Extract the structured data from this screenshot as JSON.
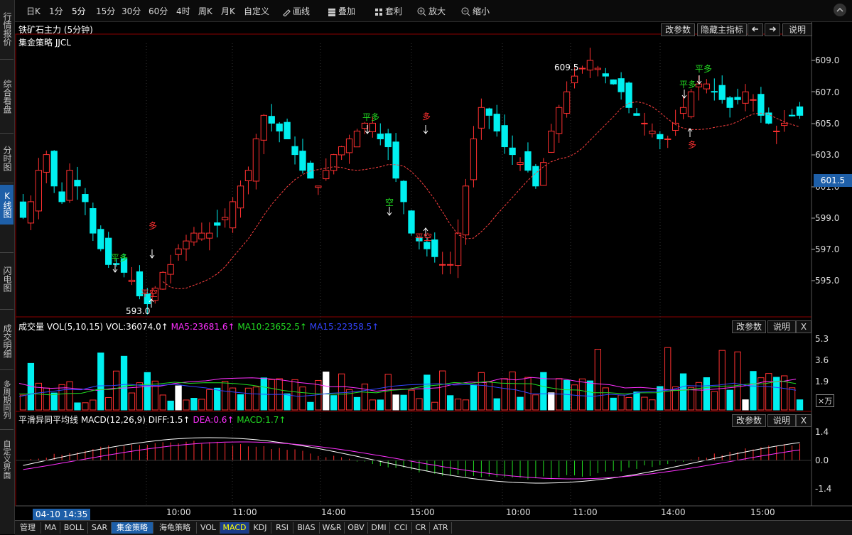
{
  "left_nav": [
    "行情报价",
    "综合看盘",
    "分时图",
    "K线图",
    "闪电图",
    "成交明细",
    "多周期同列",
    "自定义界面"
  ],
  "toolbar": {
    "periods": [
      "日K",
      "1分",
      "5分",
      "15分",
      "30分",
      "60分",
      "4时",
      "周K",
      "月K",
      "自定义"
    ],
    "active_period": "5分",
    "draw": "画线",
    "overlay": "叠加",
    "arbitrage": "套利",
    "zoom_in": "放大",
    "zoom_out": "缩小"
  },
  "main_panel": {
    "instrument": "铁矿石主力 (5分钟)",
    "strategy": "集金策略 JJCL",
    "btn_params": "改参数",
    "btn_hide": "隐藏主指标",
    "btn_help": "说明",
    "price_axis": [
      "609.0",
      "607.0",
      "605.0",
      "603.0",
      "601.0",
      "599.0",
      "597.0",
      "595.0"
    ],
    "current_price": "601.5",
    "high_label": "609.5",
    "low_label": "593.0",
    "signals": [
      {
        "text": "平多",
        "color": "#22dd22",
        "arrow": "down"
      },
      {
        "text": "平空",
        "color": "#ff3030",
        "arrow": "up"
      },
      {
        "text": "多",
        "color": "#ff3030",
        "arrow": "down"
      },
      {
        "text": "平多",
        "color": "#22dd22",
        "arrow": "down"
      },
      {
        "text": "空",
        "color": "#22dd22",
        "arrow": "down"
      },
      {
        "text": "多",
        "color": "#ff3030",
        "arrow": "down"
      },
      {
        "text": "平空",
        "color": "#ff3030",
        "arrow": "up"
      },
      {
        "text": "平多",
        "color": "#22dd22",
        "arrow": "down"
      },
      {
        "text": "平多",
        "color": "#22dd22",
        "arrow": "down"
      },
      {
        "text": "多",
        "color": "#ff3030",
        "arrow": "up"
      }
    ]
  },
  "volume_panel": {
    "title": "成交量 VOL(5,10,15)",
    "vol": "VOL:36074.0↑",
    "ma5": "MA5:23681.6↑",
    "ma10": "MA10:23652.5↑",
    "ma15": "MA15:22358.5↑",
    "axis": [
      "5.3",
      "3.6",
      "1.9"
    ],
    "unit": "×万",
    "btn_params": "改参数",
    "btn_help": "说明",
    "btn_close": "X",
    "colors": {
      "ma5": "#ff30ff",
      "ma10": "#22dd22",
      "ma15": "#3344ff"
    }
  },
  "macd_panel": {
    "title": "平滑异同平均线 MACD(12,26,9)",
    "diff": "DIFF:1.5↑",
    "dea": "DEA:0.6↑",
    "macd": "MACD:1.7↑",
    "axis": [
      "1.4",
      "0.0",
      "-1.4"
    ],
    "btn_params": "改参数",
    "btn_help": "说明",
    "btn_close": "X"
  },
  "time_axis": [
    "10:00",
    "11:00",
    "14:00",
    "15:00",
    "10:00",
    "11:00",
    "14:00",
    "15:00"
  ],
  "cursor_time": "04-10 14:35",
  "bottom_tabs": [
    "管理",
    "MA",
    "BOLL",
    "SAR",
    "集金策略",
    "海龟策略",
    "VOL",
    "MACD",
    "KDJ",
    "RSI",
    "BIAS",
    "W&R",
    "OBV",
    "DMI",
    "CCI",
    "CR",
    "ATR"
  ],
  "colors": {
    "up": "#ff3030",
    "down": "#00f0f0",
    "panel_border": "#8b0000",
    "ma_line": "#ff4040"
  }
}
